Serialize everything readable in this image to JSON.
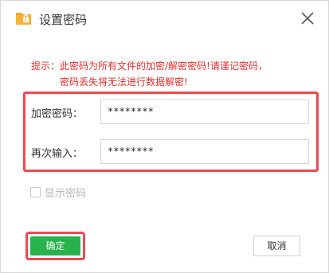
{
  "window": {
    "title": "设置密码",
    "title_icon": "folder-lock-icon",
    "close_icon": "close-icon"
  },
  "hint": {
    "line1": "提示：此密码为所有文件的加密/解密密码!请谨记密码，",
    "line2": "密码丢失将无法进行数据解密!"
  },
  "form": {
    "password_label": "加密密码：",
    "password_value": "********",
    "confirm_label": "再次输入：",
    "confirm_value": "********"
  },
  "show_password": {
    "label": "显示密码",
    "checked": false
  },
  "buttons": {
    "confirm": "确定",
    "cancel": "取消"
  },
  "colors": {
    "hint": "#e5302d",
    "highlight": "#ec4a52",
    "primary": "#27b24b",
    "folder": "#f6a623"
  }
}
